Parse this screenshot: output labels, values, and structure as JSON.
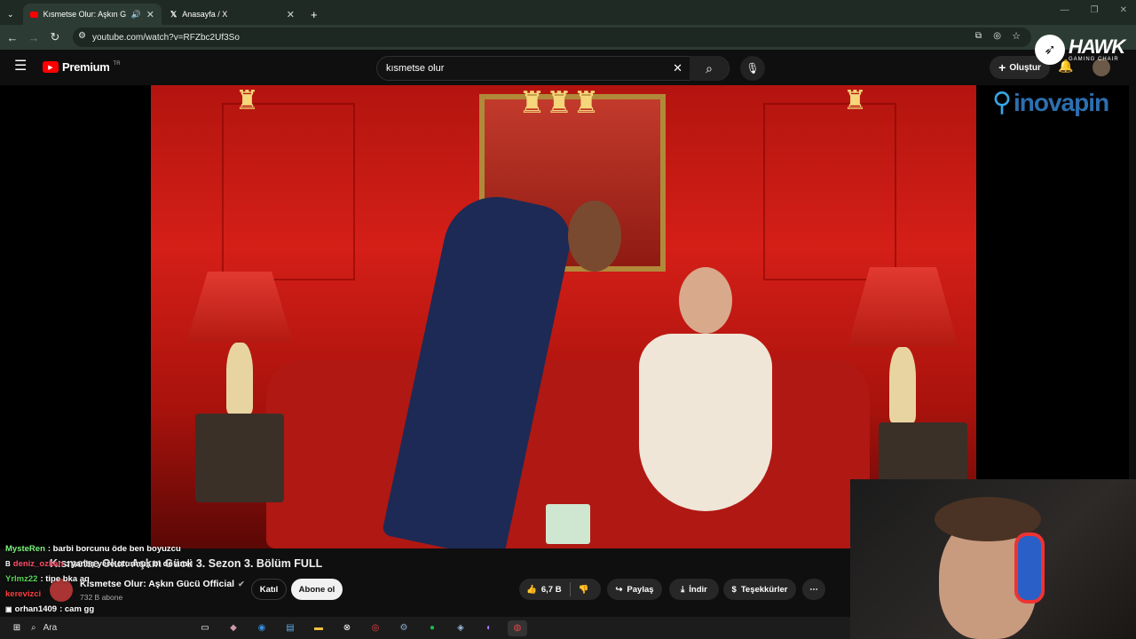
{
  "browser": {
    "tabs": [
      {
        "title": "Kısmetse Olur: Aşkın Gücü",
        "active": true
      },
      {
        "title": "Anasayfa / X",
        "active": false
      }
    ],
    "new_tab": "+",
    "url": "youtube.com/watch?v=RFZbc2Uf3So"
  },
  "youtube": {
    "logo_text": "Premium",
    "region": "TR",
    "search_value": "kısmetse olur",
    "create_label": "Oluştur"
  },
  "overlay": {
    "brand_top": "HAWK",
    "brand_sub": "GAMING CHAIR",
    "sponsor": "inovapin"
  },
  "chat": [
    {
      "user": "MysteRen",
      "color": "#7ef27e",
      "text": ": barbi borcunu öde ben boyuzcu"
    },
    {
      "user": "deniz_ozkan",
      "color": "#ff4d6a",
      "text": ": yanlış yere oturmuş bi de amk"
    },
    {
      "user": "Yrlmz22",
      "color": "#57d657",
      "text": ": tipe bka aq"
    },
    {
      "user": "kerevizci",
      "color": "#ff4040",
      "text": ""
    },
    {
      "user": "orhan1409",
      "color": "#ffffff",
      "text": ": cam gg"
    }
  ],
  "video": {
    "title": "Kısmetse Olur: Aşkın Gücü 3. Sezon 3. Bölüm FULL",
    "channel": "Kısmetse Olur: Aşkın Gücü Official",
    "subscribers": "732 B abone",
    "join_label": "Katıl",
    "subscribe_label": "Abone ol",
    "likes": "6,7 B",
    "share_label": "Paylaş",
    "download_label": "İndir",
    "thanks_label": "Teşekkürler"
  },
  "taskbar": {
    "search_label": "Ara"
  }
}
